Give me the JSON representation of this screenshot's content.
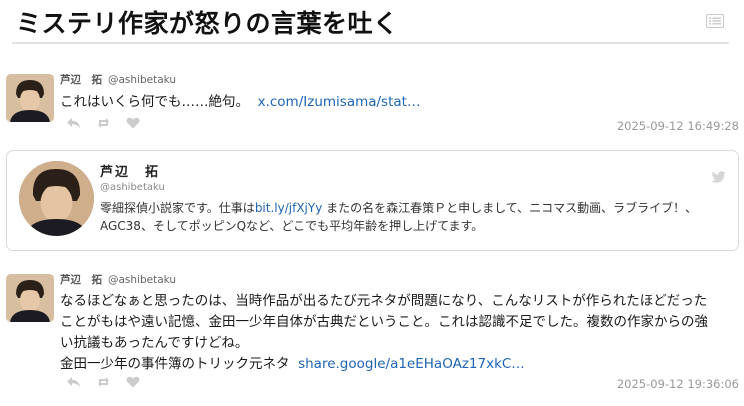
{
  "page": {
    "title": "ミステリ作家が怒りの言葉を吐く"
  },
  "tweets": [
    {
      "author_name": "芦辺　拓",
      "handle": "@ashibetaku",
      "text_lines": [
        "これはいくら何でも……絶句。"
      ],
      "link_text": "x.com/Izumisama/stat…",
      "timestamp": "2025-09-12 16:49:28"
    },
    {
      "author_name": "芦辺　拓",
      "handle": "@ashibetaku",
      "text_lines": [
        "なるほどなぁと思ったのは、当時作品が出るたび元ネタが問題になり、こんなリストが作られたほどだった",
        "ことがもはや遠い記憶、金田一少年自体が古典だということ。これは認識不足でした。複数の作家からの強",
        "い抗議もあったんですけどね。",
        "金田一少年の事件簿のトリック元ネタ"
      ],
      "link_text": "share.google/a1eEHaOAz17xkC…",
      "timestamp": "2025-09-12 19:36:06"
    }
  ],
  "profile_card": {
    "name": "芦辺　拓",
    "handle": "@ashibetaku",
    "bio_before_link": "零細探偵小説家です。仕事は",
    "bio_link": "bit.ly/jfXjYy",
    "bio_after_link": " またの名を森江春策Ｐと申しまして、ニコマス動画、ラブライブ！、",
    "bio_line2": "AGC38、そしてポッピンQなど、どこでも平均年齢を押し上げてます。"
  },
  "icons": {
    "menu": "list-icon",
    "reply": "reply-icon",
    "retweet": "retweet-icon",
    "like": "heart-icon",
    "bird": "twitter-bird-icon"
  },
  "colors": {
    "link": "#1e64b4",
    "timestamp": "#999999",
    "action_icon": "#cccccc"
  }
}
